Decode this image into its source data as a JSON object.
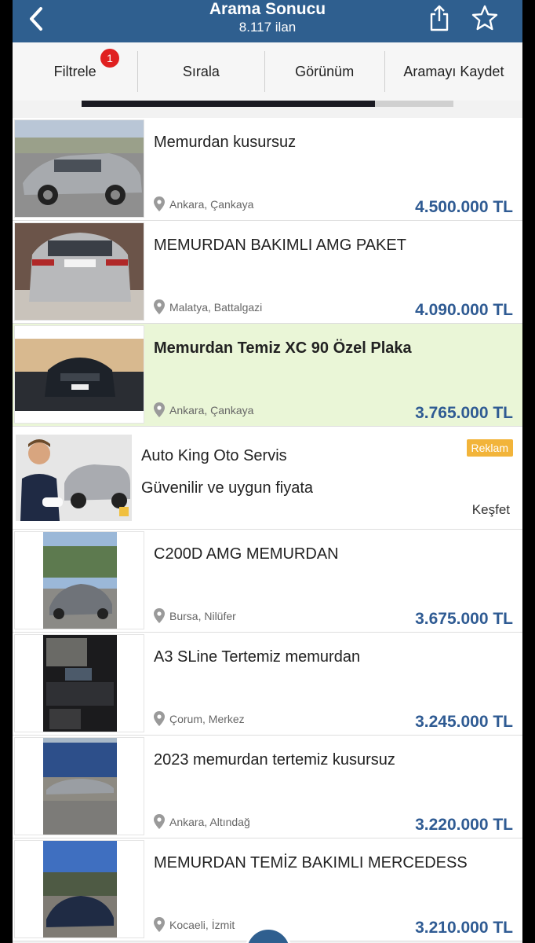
{
  "header": {
    "title": "Arama Sonucu",
    "subtitle": "8.117 ilan",
    "back_icon": "chevron-left-icon",
    "share_icon": "share-icon",
    "favorite_icon": "star-icon",
    "color": "#2f5f8f"
  },
  "toolbar": {
    "filter_label": "Filtrele",
    "filter_badge": "1",
    "sort_label": "Sırala",
    "view_label": "Görünüm",
    "save_label": "Aramayı Kaydet"
  },
  "listings": [
    {
      "title": "Memurdan kusursuz",
      "location": "Ankara, Çankaya",
      "price": "4.500.000 TL",
      "highlight": false
    },
    {
      "title": "MEMURDAN BAKIMLI AMG PAKET",
      "location": "Malatya, Battalgazi",
      "price": "4.090.000 TL",
      "highlight": false
    },
    {
      "title": "Memurdan Temiz XC 90 Özel Plaka",
      "location": "Ankara, Çankaya",
      "price": "3.765.000 TL",
      "highlight": true
    }
  ],
  "ad": {
    "name": "Auto King Oto Servis",
    "description": "Güvenilir ve uygun fiyata",
    "badge": "Reklam",
    "link": "Keşfet"
  },
  "listings2": [
    {
      "title": "C200D AMG MEMURDAN",
      "location": "Bursa, Nilüfer",
      "price": "3.675.000 TL"
    },
    {
      "title": "A3 SLine Tertemiz memurdan",
      "location": "Çorum, Merkez",
      "price": "3.245.000 TL"
    },
    {
      "title": "2023 memurdan tertemiz kusursuz",
      "location": "Ankara, Altındağ",
      "price": "3.220.000 TL"
    },
    {
      "title": "MEMURDAN TEMİZ BAKIMLI MERCEDESS",
      "location": "Kocaeli, İzmit",
      "price": "3.210.000 TL"
    }
  ],
  "colors": {
    "price": "#2f5b93",
    "highlight_bg": "#eaf6d7",
    "badge_red": "#e02020",
    "ad_badge": "#f2b43a"
  }
}
